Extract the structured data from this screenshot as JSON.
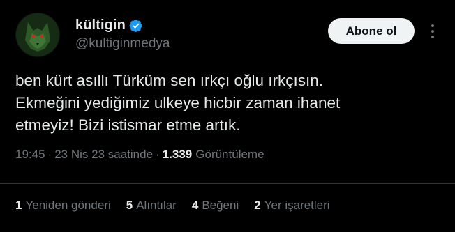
{
  "author": {
    "display_name": "kültigin",
    "handle": "@kultiginmedya",
    "verified": true,
    "avatar_icon": "wolf-avatar-icon"
  },
  "actions": {
    "follow_label": "Abone ol",
    "more_icon": "more-vertical-icon"
  },
  "tweet": {
    "text": "ben kürt asıllı Türküm sen ırkçı oğlu ırkçısın.\nEkmeğini yediğimiz ulkeye hicbir zaman ihanet\netmeyiz! Bizi istismar etme artık.",
    "time": "19:45",
    "date": "23 Nis 23 saatinde",
    "views_count": "1.339",
    "views_label": "Görüntüleme"
  },
  "stats": [
    {
      "count": "1",
      "label": "Yeniden gönderi"
    },
    {
      "count": "5",
      "label": "Alıntılar"
    },
    {
      "count": "4",
      "label": "Beğeni"
    },
    {
      "count": "2",
      "label": "Yer işaretleri"
    }
  ],
  "colors": {
    "background": "#000000",
    "text_primary": "#e7e9ea",
    "text_secondary": "#71767b",
    "verified_blue": "#1d9bf0",
    "button_bg": "#eff3f4",
    "divider": "#2f3336"
  }
}
